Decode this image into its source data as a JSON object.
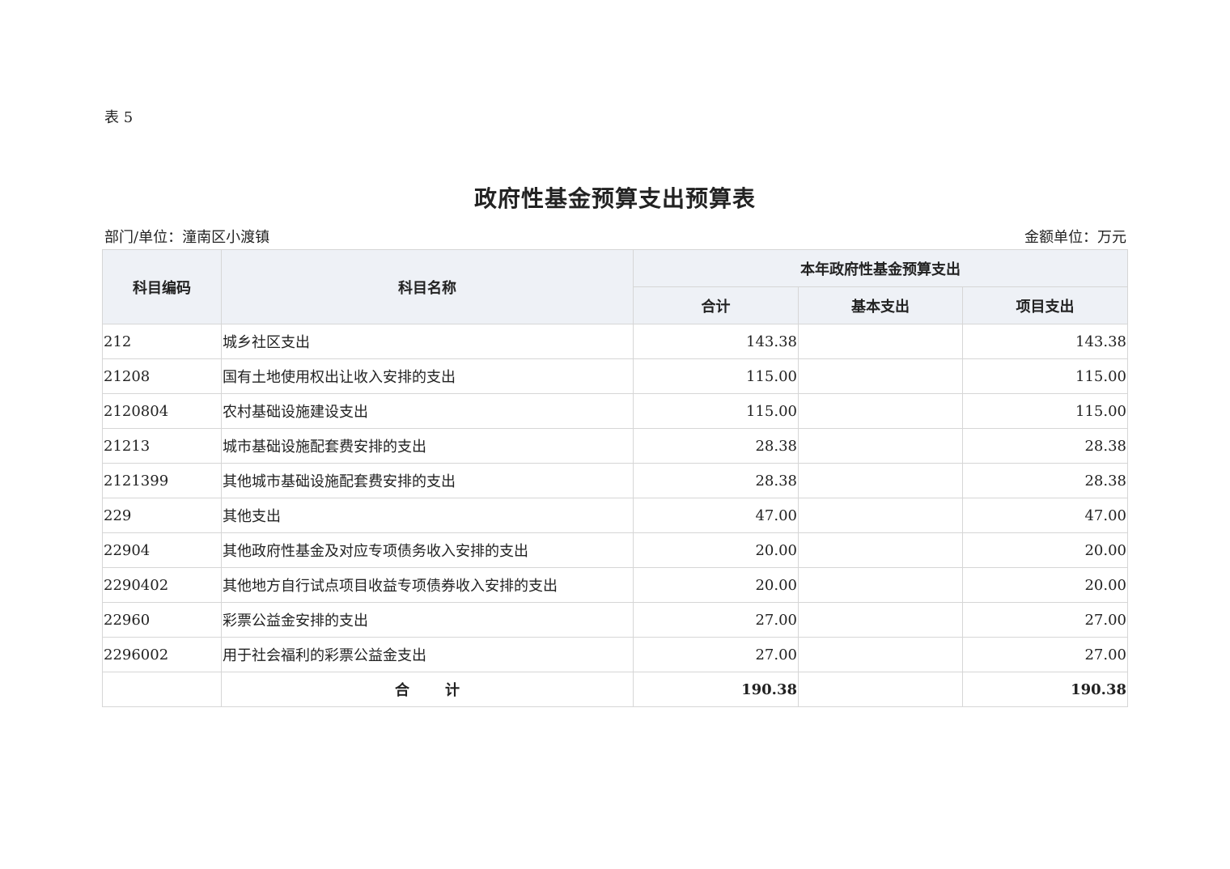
{
  "doc": {
    "table_label": "表 5",
    "title": "政府性基金预算支出预算表",
    "department": "部门/单位：潼南区小渡镇",
    "unit": "金额单位：万元"
  },
  "table": {
    "headers": {
      "code": "科目编码",
      "name": "科目名称",
      "group": "本年政府性基金预算支出",
      "total": "合计",
      "basic": "基本支出",
      "project": "项目支出"
    },
    "rows": [
      {
        "code": "212",
        "name": "城乡社区支出",
        "level": 1,
        "total": "143.38",
        "basic": "",
        "project": "143.38"
      },
      {
        "code": "21208",
        "name": "国有土地使用权出让收入安排的支出",
        "level": 2,
        "total": "115.00",
        "basic": "",
        "project": "115.00"
      },
      {
        "code": "2120804",
        "name": "农村基础设施建设支出",
        "level": 3,
        "total": "115.00",
        "basic": "",
        "project": "115.00"
      },
      {
        "code": "21213",
        "name": "城市基础设施配套费安排的支出",
        "level": 2,
        "total": "28.38",
        "basic": "",
        "project": "28.38"
      },
      {
        "code": "2121399",
        "name": "其他城市基础设施配套费安排的支出",
        "level": 3,
        "total": "28.38",
        "basic": "",
        "project": "28.38"
      },
      {
        "code": "229",
        "name": "其他支出",
        "level": 1,
        "total": "47.00",
        "basic": "",
        "project": "47.00"
      },
      {
        "code": "22904",
        "name": "其他政府性基金及对应专项债务收入安排的支出",
        "level": 2,
        "total": "20.00",
        "basic": "",
        "project": "20.00"
      },
      {
        "code": "2290402",
        "name": "其他地方自行试点项目收益专项债券收入安排的支出",
        "level": 3,
        "total": "20.00",
        "basic": "",
        "project": "20.00"
      },
      {
        "code": "22960",
        "name": "彩票公益金安排的支出",
        "level": 2,
        "total": "27.00",
        "basic": "",
        "project": "27.00"
      },
      {
        "code": "2296002",
        "name": "用于社会福利的彩票公益金支出",
        "level": 3,
        "total": "27.00",
        "basic": "",
        "project": "27.00"
      }
    ],
    "footer": {
      "label_a": "合",
      "label_b": "计",
      "total": "190.38",
      "basic": "",
      "project": "190.38"
    }
  }
}
